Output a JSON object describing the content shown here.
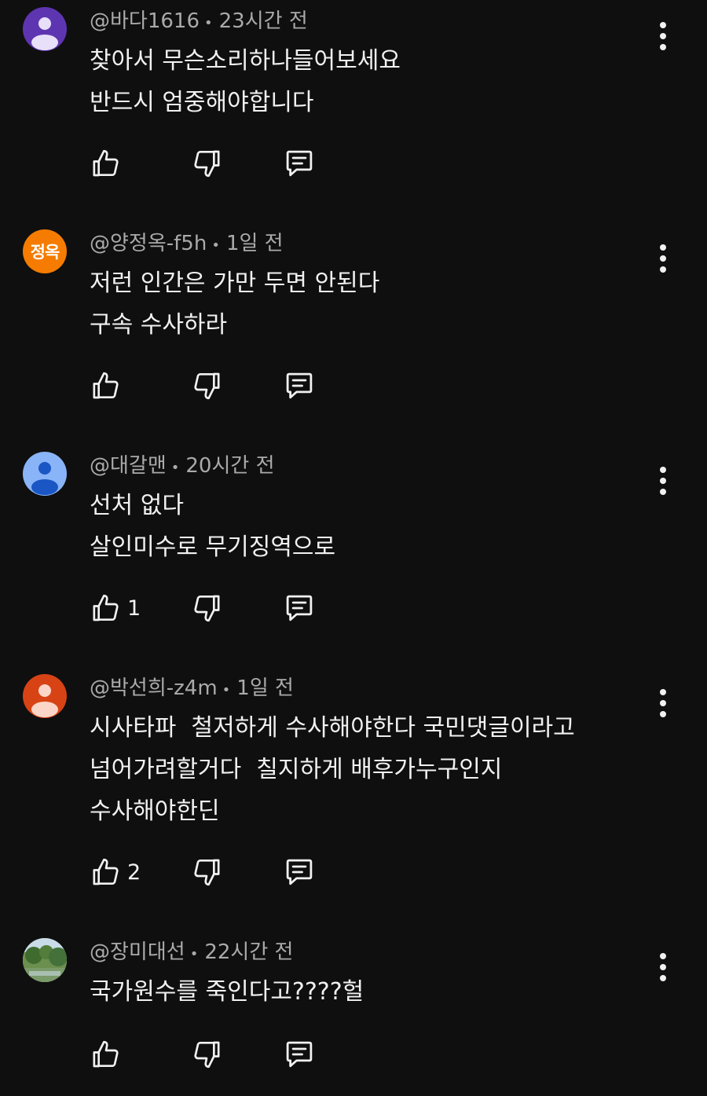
{
  "comments": [
    {
      "author": "@바다1616",
      "time": "23시간 전",
      "line1": "찾아서 무슨소리하나들어보세요",
      "line2": "반드시 엄중해야합니다",
      "line3": "",
      "likes": "",
      "avatar_color": "#5e35b1",
      "avatar_type": "person",
      "avatar_initials": ""
    },
    {
      "author": "@양정옥-f5h",
      "time": "1일 전",
      "line1": "저런 인간은 가만 두면 안된다",
      "line2": "구속 수사하라",
      "line3": "",
      "likes": "",
      "avatar_color": "#f57c00",
      "avatar_type": "initials",
      "avatar_initials": "정옥"
    },
    {
      "author": "@대갈맨",
      "time": "20시간 전",
      "line1": "선처 없다",
      "line2": "살인미수로 무기징역으로",
      "line3": "",
      "likes": "1",
      "avatar_color": "#8ab4f8",
      "avatar_type": "person",
      "avatar_initials": ""
    },
    {
      "author": "@박선희-z4m",
      "time": "1일 전",
      "line1": "시사타파  철저하게 수사해야한다 국민댓글이라고",
      "line2": "넘어가려할거다  칠지하게 배후가누구인지",
      "line3": "수사해야한딘",
      "likes": "2",
      "avatar_color": "#d84315",
      "avatar_type": "person",
      "avatar_initials": ""
    },
    {
      "author": "@장미대선",
      "time": "22시간 전",
      "line1": "국가원수를 죽인다고????헐",
      "line2": "",
      "line3": "",
      "likes": "",
      "avatar_color": "#6b8f4e",
      "avatar_type": "photo",
      "avatar_initials": ""
    }
  ],
  "icons": {
    "like": "thumb-up-outline-icon",
    "dislike": "thumb-down-outline-icon",
    "reply": "comment-reply-icon",
    "more": "more-vertical-icon"
  },
  "colors": {
    "background": "#0f0f0f",
    "text": "#f1f1f1",
    "meta": "#aaaaaa"
  }
}
